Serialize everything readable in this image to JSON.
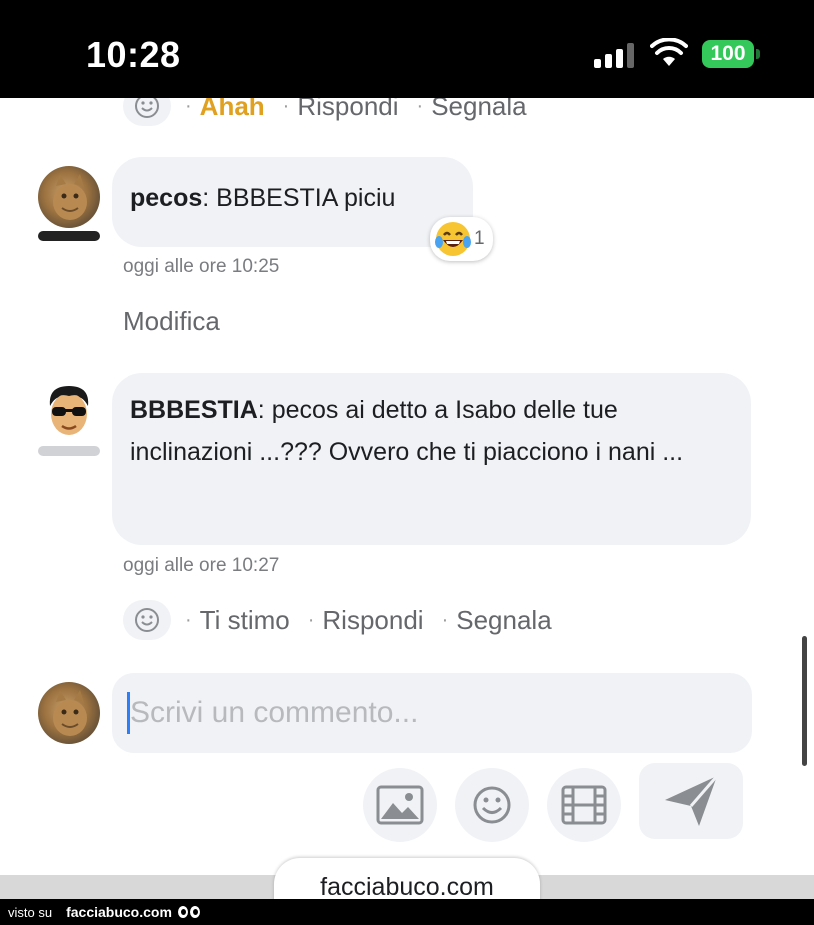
{
  "status_bar": {
    "time": "10:28",
    "battery": "100"
  },
  "prev_actions": {
    "reaction": "Ahah",
    "reply": "Rispondi",
    "report": "Segnala"
  },
  "comments": [
    {
      "author": "pecos",
      "text": ": BBBESTIA piciu",
      "timestamp": "oggi alle ore 10:25",
      "reaction_icon": "laughing-tears-emoji",
      "reaction_count": "1",
      "edit_label": "Modifica"
    },
    {
      "author": "BBBESTIA",
      "text": ": pecos ai detto a Isabo delle tue inclinazioni ...??? Ovvero che ti piacciono i nani ...",
      "timestamp": "oggi alle ore 10:27",
      "actions": {
        "reaction": "Ti stimo",
        "reply": "Rispondi",
        "report": "Segnala"
      }
    }
  ],
  "composer": {
    "placeholder": "Scrivi un commento...",
    "tools": [
      "image-icon",
      "smiley-icon",
      "film-icon",
      "send-icon"
    ]
  },
  "footer": {
    "site": "facciabuco.com",
    "watermark_prefix": "visto su",
    "watermark_brand": "facciabuco.com"
  }
}
